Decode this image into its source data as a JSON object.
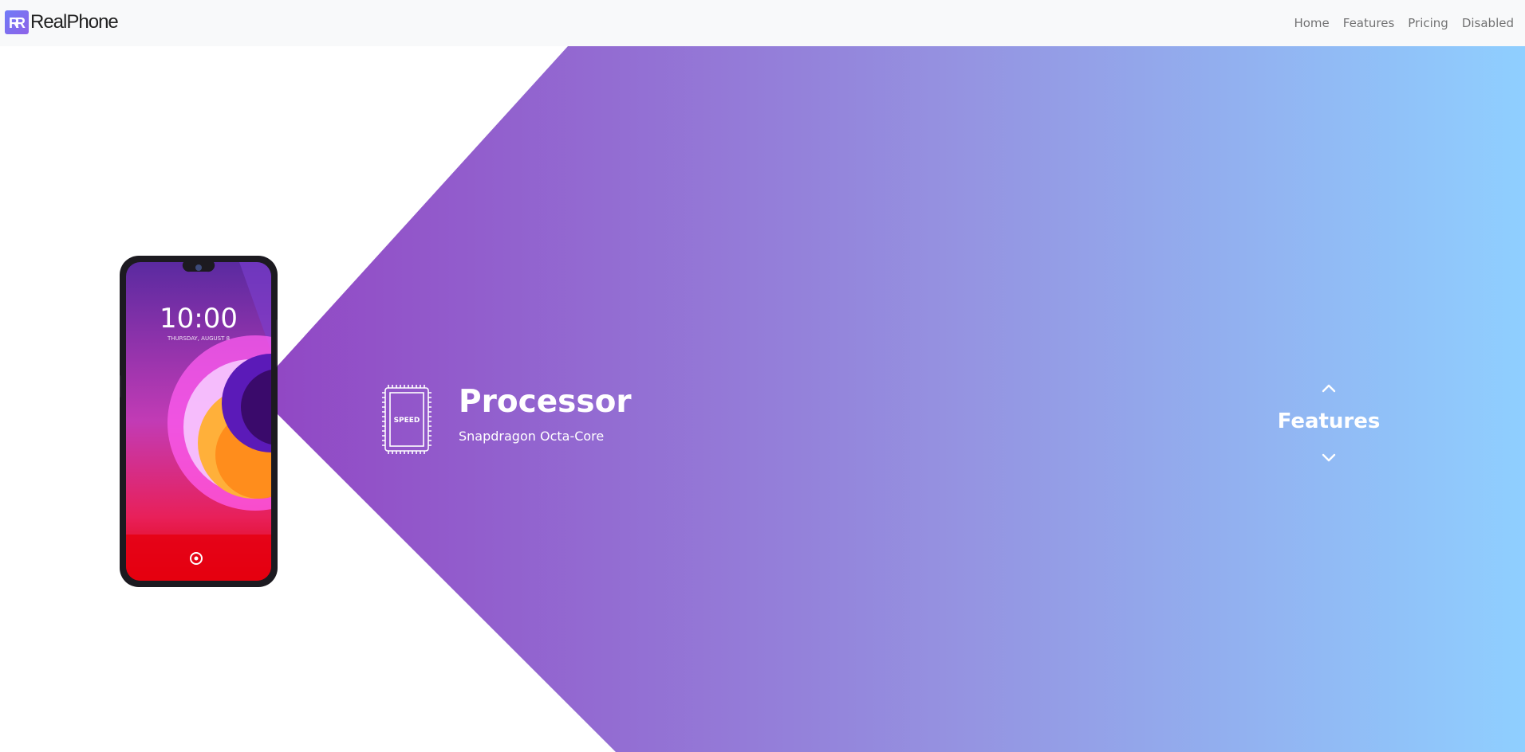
{
  "brand": {
    "name": "RealPhone",
    "logo_letters": "R",
    "logo_icon": "double-r-logo"
  },
  "nav": {
    "items": [
      "Home",
      "Features",
      "Pricing",
      "Disabled"
    ]
  },
  "hero": {
    "gradient": [
      "#9147c4",
      "#8fcfff"
    ],
    "phone": {
      "time": "10:00",
      "date": "THURSDAY, AUGUST 8"
    },
    "feature": {
      "icon": "speed-chip-icon",
      "chip_label": "SPEED",
      "title": "Processor",
      "subtitle": "Snapdragon Octa-Core"
    },
    "section_nav": {
      "label": "Features",
      "up_icon": "chevron-up-icon",
      "down_icon": "chevron-down-icon"
    }
  }
}
